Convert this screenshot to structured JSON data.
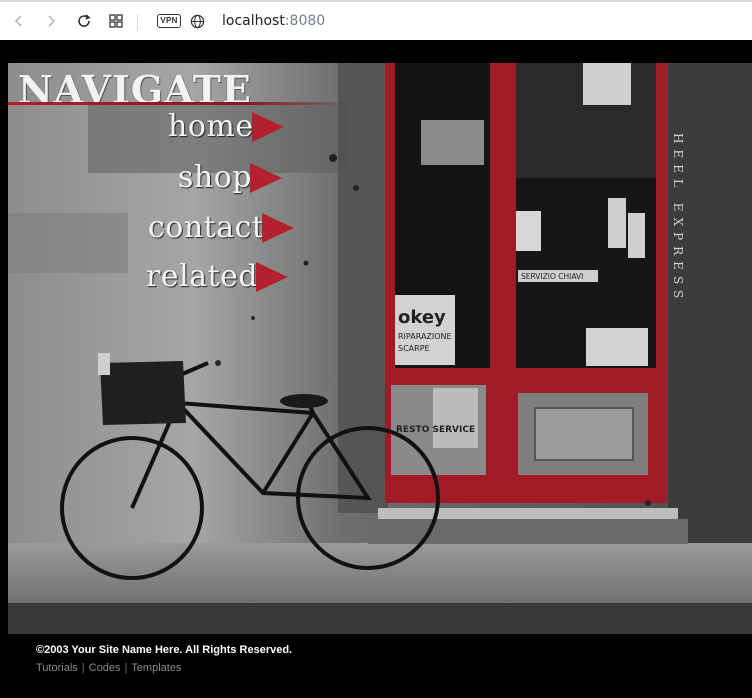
{
  "browser": {
    "url_host": "localhost",
    "url_port": ":8080",
    "vpn_label": "VPN",
    "icons": [
      "back-arrow-icon",
      "forward-arrow-icon",
      "reload-icon",
      "tab-grid-icon",
      "globe-icon"
    ]
  },
  "hero": {
    "nav_title": "NAVIGATE",
    "nav_links": [
      "home",
      "shop",
      "contact",
      "related"
    ],
    "accent_color": "#b3212e",
    "scene_text": {
      "door_sign": "SERVIZIO CHIAVI",
      "poster_brand": "okey",
      "poster_line1": "RIPARAZIONE",
      "poster_line2": "SCARPE",
      "panel_sign": "RESTO SERVICE",
      "vertical_sign": "HEEL EXPRESS"
    }
  },
  "footer": {
    "copyright": "©2003 Your Site Name Here. All Rights Reserved.",
    "links": [
      "Tutorials",
      "Codes",
      "Templates"
    ],
    "separator": "|"
  }
}
